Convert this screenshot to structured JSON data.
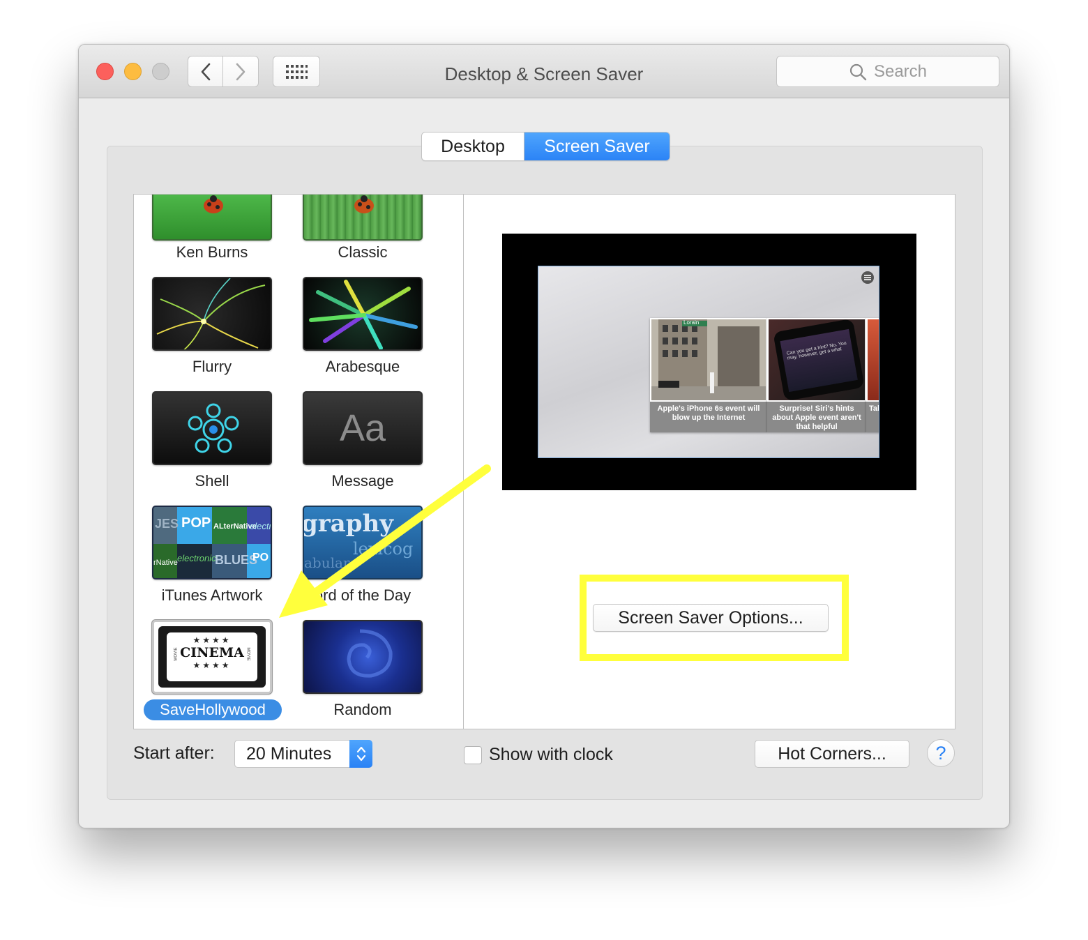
{
  "window": {
    "title": "Desktop & Screen Saver"
  },
  "search": {
    "placeholder": "Search"
  },
  "tabs": [
    {
      "label": "Desktop",
      "selected": false
    },
    {
      "label": "Screen Saver",
      "selected": true
    }
  ],
  "screensavers": [
    {
      "label": "Ken Burns",
      "selected": false
    },
    {
      "label": "Classic",
      "selected": false
    },
    {
      "label": "Flurry",
      "selected": false
    },
    {
      "label": "Arabesque",
      "selected": false
    },
    {
      "label": "Shell",
      "selected": false
    },
    {
      "label": "Message",
      "selected": false
    },
    {
      "label": "iTunes Artwork",
      "selected": false
    },
    {
      "label": "ord of the Day",
      "selected": false
    },
    {
      "label": "SaveHollywood",
      "selected": true
    },
    {
      "label": "Random",
      "selected": false
    }
  ],
  "thumb_text": {
    "message_glyph": "Aa",
    "cinema_stars": "★★★★",
    "cinema_word": "CINEMA",
    "cinema_side": "MOVIE",
    "word_top": "graphy",
    "word_mid": "lexicog",
    "word_low": "abular",
    "itunes_words": [
      "POP",
      "ALterNative",
      "electronic",
      "BLUES",
      "electr",
      "rNative",
      "JES",
      "PO"
    ]
  },
  "preview": {
    "cards": [
      {
        "caption": "Apple's iPhone 6s event will blow up the Internet",
        "sign": "Lorain"
      },
      {
        "caption": "Surprise! Siri's hints about Apple event aren't that helpful",
        "phone_text": "Can you get a hint? No. You may, however, get a what"
      },
      {
        "caption": "Tak"
      }
    ]
  },
  "options_button": "Screen Saver Options...",
  "start_after": {
    "label": "Start after:",
    "value": "20 Minutes"
  },
  "show_with_clock": {
    "label": "Show with clock",
    "checked": false
  },
  "hot_corners_button": "Hot Corners...",
  "help_button": "?",
  "colors": {
    "accent": "#2b83f6",
    "highlight": "#ffff3c",
    "selection": "#3b8de4"
  }
}
